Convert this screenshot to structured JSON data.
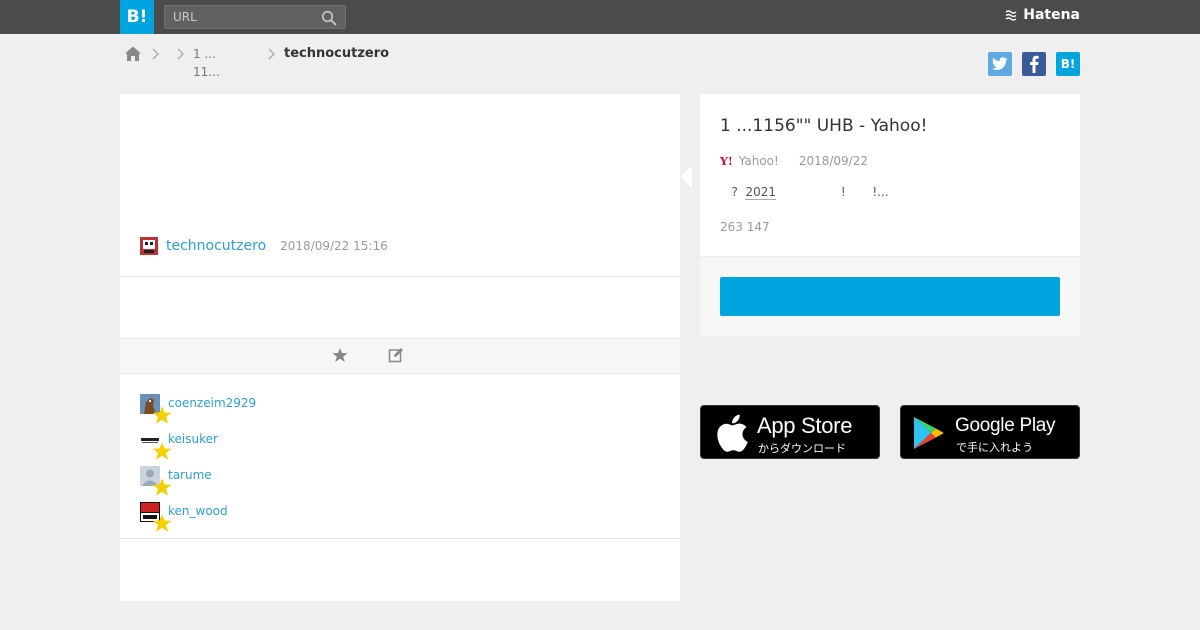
{
  "topbar": {
    "logo_text": "B!",
    "search_placeholder": "URL",
    "brand": "Hatena",
    "colors": {
      "background": "#4b4b4b",
      "logo": "#00a4de"
    }
  },
  "breadcrumb": {
    "items": [
      {
        "line1": "1 ...",
        "line2": "11..."
      }
    ],
    "current": "technocutzero"
  },
  "share": {
    "twitter": "twitter-icon",
    "facebook": "facebook-icon",
    "hatena": "B!"
  },
  "entry": {
    "author": "technocutzero",
    "timestamp": "2018/09/22 15:16"
  },
  "stars": {
    "users": [
      {
        "name": "coenzeim2929"
      },
      {
        "name": "keisuker"
      },
      {
        "name": "tarume"
      },
      {
        "name": "ken_wood"
      }
    ]
  },
  "article": {
    "title": "1 ...1156\"\" UHB - Yahoo!",
    "source": "Yahoo!",
    "date": "2018/09/22",
    "desc_before": "   ?  ",
    "desc_underlined": "2021",
    "desc_after": "                 !       !...",
    "counts": "263 147",
    "button_label": ""
  },
  "app_store": {
    "main": "App Store",
    "sub": "からダウンロード"
  },
  "google_play": {
    "main": "Google Play",
    "sub": "で手に入れよう"
  },
  "accent_color": "#00a4de",
  "link_color": "#2d9fd4"
}
